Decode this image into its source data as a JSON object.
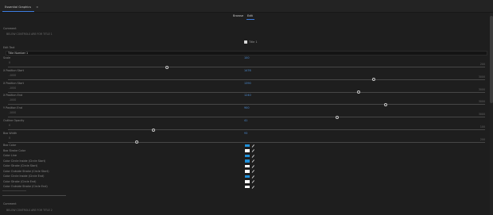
{
  "tab": {
    "title": "Essential Graphics",
    "close": "≡"
  },
  "modes": {
    "browse": "Browse",
    "edit": "Edit"
  },
  "comment_top": {
    "label": "Comment",
    "value": "BELOW CONTROLS ARE FOR TITLE 1"
  },
  "checkbox": {
    "label": "Title 1",
    "checked": true
  },
  "edit_text": {
    "label": "Edit Text",
    "value": "Title Number 1"
  },
  "sliders": [
    {
      "label": "Scale",
      "value": "100",
      "min": "0",
      "max": "200",
      "fraction": 0.333
    },
    {
      "label": "X Position Start",
      "value": "1476",
      "min": "-1000",
      "max": "3000",
      "fraction": 0.767
    },
    {
      "label": "X Position Start",
      "value": "1390",
      "min": "-1000",
      "max": "3000",
      "fraction": 0.735
    },
    {
      "label": "X Position End",
      "value": "1240",
      "min": "-1000",
      "max": "3000",
      "fraction": 0.792
    },
    {
      "label": "Y Position End",
      "value": "900",
      "min": "-1000",
      "max": "3000",
      "fraction": 0.69
    },
    {
      "label": "Outline Opacity",
      "value": "41",
      "min": "0",
      "max": "100",
      "fraction": 0.305
    },
    {
      "label": "Box Width",
      "value": "93",
      "min": "0",
      "max": "200",
      "fraction": 0.27
    }
  ],
  "colors": [
    {
      "label": "Box Color",
      "hex": "#1f8fd8"
    },
    {
      "label": "Box Stroke Color",
      "hex": "#ffffff"
    },
    {
      "label": "Color Line",
      "hex": "#1f8fd8"
    },
    {
      "label": "Color Circle Inside (Circle Start)",
      "hex": "#1f8fd8"
    },
    {
      "label": "Color Stroke (Circle Start)",
      "hex": "#ffffff"
    },
    {
      "label": "Color Outside Stroke (Circle Start)",
      "hex": "#ffffff"
    },
    {
      "label": "Color Circle Inside (Circle End)",
      "hex": "#1f8fd8"
    },
    {
      "label": "Color Stroke (Circle End)",
      "hex": "#ffffff"
    },
    {
      "label": "Color Outside Stroke (Circle End)",
      "hex": "#ffffff"
    }
  ],
  "comment_bottom": {
    "label": "Comment",
    "value": "BELOW CONTROLS ARE FOR TITLE 2"
  }
}
